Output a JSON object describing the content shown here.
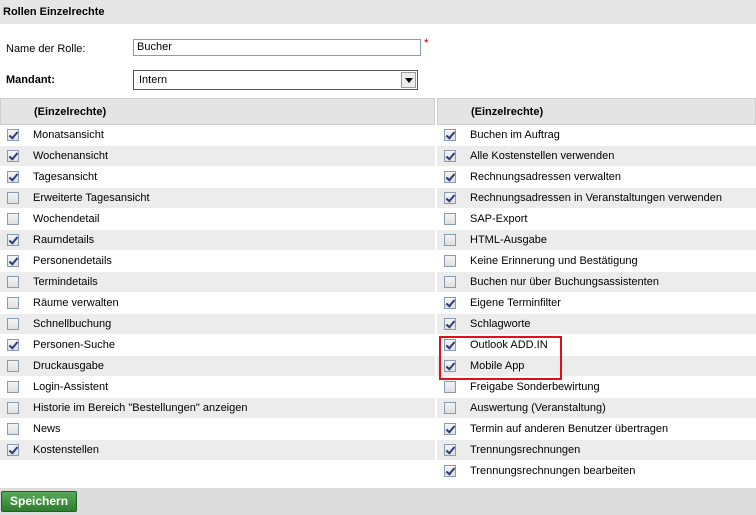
{
  "title": "Rollen Einzelrechte",
  "form": {
    "role_label": "Name der Rolle:",
    "role_value": "Bucher",
    "required_mark": "*",
    "mandant_label": "Mandant:",
    "mandant_value": "Intern"
  },
  "left": {
    "header": "(Einzelrechte)",
    "items": [
      {
        "label": "Monatsansicht",
        "checked": true
      },
      {
        "label": "Wochenansicht",
        "checked": true
      },
      {
        "label": "Tagesansicht",
        "checked": true
      },
      {
        "label": "Erweiterte Tagesansicht",
        "checked": false
      },
      {
        "label": "Wochendetail",
        "checked": false
      },
      {
        "label": "Raumdetails",
        "checked": true
      },
      {
        "label": "Personendetails",
        "checked": true
      },
      {
        "label": "Termindetails",
        "checked": false
      },
      {
        "label": "Räume verwalten",
        "checked": false
      },
      {
        "label": "Schnellbuchung",
        "checked": false
      },
      {
        "label": "Personen-Suche",
        "checked": true
      },
      {
        "label": "Druckausgabe",
        "checked": false
      },
      {
        "label": "Login-Assistent",
        "checked": false
      },
      {
        "label": "Historie im Bereich \"Bestellungen\" anzeigen",
        "checked": false
      },
      {
        "label": "News",
        "checked": false
      },
      {
        "label": "Kostenstellen",
        "checked": true
      }
    ]
  },
  "right": {
    "header": "(Einzelrechte)",
    "items": [
      {
        "label": "Buchen im Auftrag",
        "checked": true
      },
      {
        "label": "Alle Kostenstellen verwenden",
        "checked": true
      },
      {
        "label": "Rechnungsadressen verwalten",
        "checked": true
      },
      {
        "label": "Rechnungsadressen in Veranstaltungen verwenden",
        "checked": true
      },
      {
        "label": "SAP-Export",
        "checked": false
      },
      {
        "label": "HTML-Ausgabe",
        "checked": false
      },
      {
        "label": "Keine Erinnerung und Bestätigung",
        "checked": false
      },
      {
        "label": "Buchen nur über Buchungsassistenten",
        "checked": false
      },
      {
        "label": "Eigene Terminfilter",
        "checked": true
      },
      {
        "label": "Schlagworte",
        "checked": true
      },
      {
        "label": "Outlook ADD.IN",
        "checked": true
      },
      {
        "label": "Mobile App",
        "checked": true
      },
      {
        "label": "Freigabe Sonderbewirtung",
        "checked": false
      },
      {
        "label": "Auswertung (Veranstaltung)",
        "checked": false
      },
      {
        "label": "Termin auf anderen Benutzer übertragen",
        "checked": true
      },
      {
        "label": "Trennungsrechnungen",
        "checked": true
      },
      {
        "label": "Trennungsrechnungen bearbeiten",
        "checked": true
      }
    ]
  },
  "footer": {
    "save_label": "Speichern"
  },
  "colors": {
    "highlight": "#e0101a",
    "save_button": "#3d8f3d"
  }
}
